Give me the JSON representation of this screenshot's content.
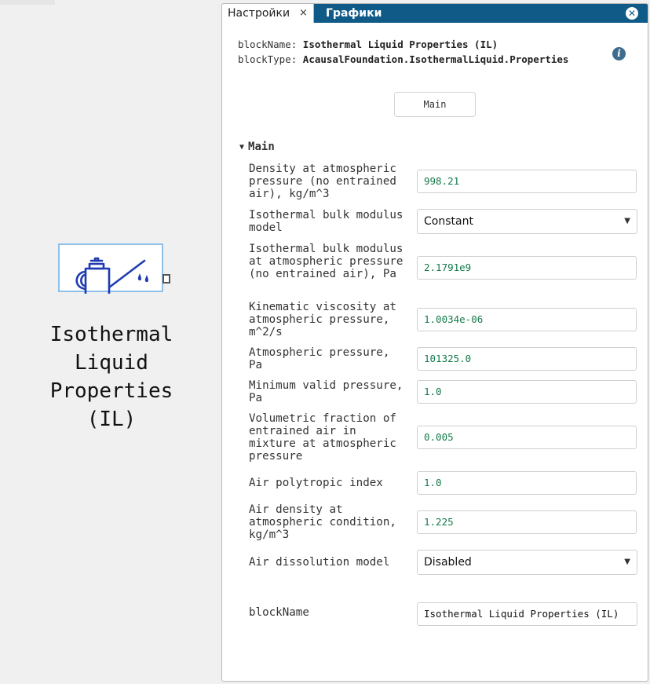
{
  "block": {
    "label_lines": [
      "Isothermal",
      "Liquid",
      "Properties",
      "(IL)"
    ],
    "icon": "oil-can-icon"
  },
  "panel": {
    "tabs": [
      {
        "label": "Настройки",
        "active": true
      },
      {
        "label": "Графики",
        "active": false
      }
    ],
    "close_tab_glyph": "×",
    "close_panel_glyph": "✕",
    "blockName_key": "blockName:",
    "blockName_value": "Isothermal Liquid Properties (IL)",
    "blockType_key": "blockType:",
    "blockType_value": "AcausalFoundation.IsothermalLiquid.Properties",
    "info_glyph": "i",
    "main_tab": "Main",
    "section_title": "Main",
    "section_caret": "▼",
    "params": [
      {
        "label": "Density at atmospheric pressure (no entrained air), kg/m^3",
        "value": "998.21"
      },
      {
        "label": "Isothermal bulk modulus model",
        "value": "Constant"
      },
      {
        "label": "Isothermal bulk modulus at atmospheric pressure (no entrained air), Pa",
        "value": "2.1791e9"
      },
      {
        "label": "Kinematic viscosity at atmospheric pressure, m^2/s",
        "value": "1.0034e-06"
      },
      {
        "label": "Atmospheric pressure, Pa",
        "value": "101325.0"
      },
      {
        "label": "Minimum valid pressure, Pa",
        "value": "1.0"
      },
      {
        "label": "Volumetric fraction of entrained air in mixture at atmospheric pressure",
        "value": "0.005"
      },
      {
        "label": "Air polytropic index",
        "value": "1.0"
      },
      {
        "label": "Air density at atmospheric condition, kg/m^3",
        "value": "1.225"
      },
      {
        "label": "Air dissolution model",
        "value": "Disabled"
      }
    ],
    "blockname_label": "blockName",
    "blockname_value": "Isothermal Liquid Properties (IL)"
  },
  "colors": {
    "tabbar": "#105a87",
    "value_green": "#137a4a",
    "block_border": "#8fc0ea",
    "icon_blue": "#1f3bb3"
  }
}
